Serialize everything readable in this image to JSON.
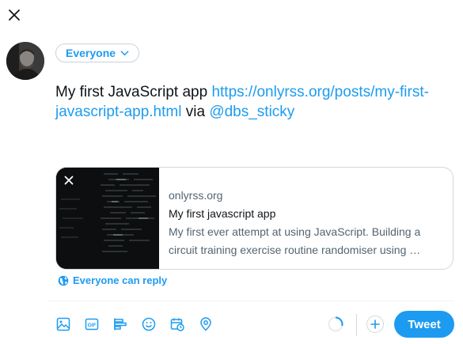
{
  "header": {
    "close_icon": "close-icon"
  },
  "composer": {
    "audience_label": "Everyone",
    "text_prefix": "My first JavaScript app ",
    "link_text": "https://onlyrss.org/posts/my-first-javascript-app.html",
    "via_text": " via ",
    "mention_text": "@dbs_sticky"
  },
  "card": {
    "domain": "onlyrss.org",
    "title": "My first javascript app",
    "description": "My first ever attempt at using JavaScript. Building a circuit training exercise routine randomiser using …"
  },
  "reply": {
    "label": "Everyone can reply",
    "icon": "globe-icon"
  },
  "toolbar": {
    "icons": [
      "image-icon",
      "gif-icon",
      "poll-icon",
      "emoji-icon",
      "schedule-icon",
      "location-icon"
    ],
    "tweet_label": "Tweet"
  },
  "colors": {
    "accent": "#1d9bf0",
    "text": "#0f1419",
    "muted": "#536471",
    "border": "#cfd9de"
  }
}
